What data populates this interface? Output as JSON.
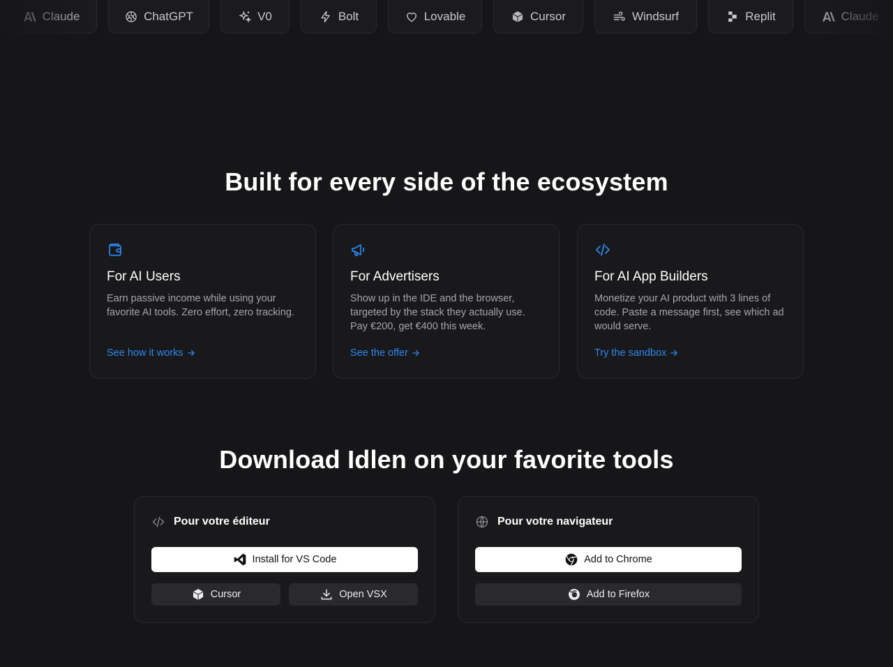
{
  "tool_strip": {
    "items": [
      {
        "label": "Claude",
        "icon": "anthropic-icon"
      },
      {
        "label": "ChatGPT",
        "icon": "openai-icon"
      },
      {
        "label": "V0",
        "icon": "sparkles-icon"
      },
      {
        "label": "Bolt",
        "icon": "bolt-icon"
      },
      {
        "label": "Lovable",
        "icon": "heart-icon"
      },
      {
        "label": "Cursor",
        "icon": "cube-icon"
      },
      {
        "label": "Windsurf",
        "icon": "wind-icon"
      },
      {
        "label": "Replit",
        "icon": "replit-icon"
      },
      {
        "label": "Claude",
        "icon": "anthropic-icon"
      }
    ]
  },
  "ecosystem": {
    "title": "Built for every side of the ecosystem",
    "cards": [
      {
        "icon": "wallet-icon",
        "title": "For AI Users",
        "description": "Earn passive income while using your favorite AI tools. Zero effort, zero tracking.",
        "link": "See how it works"
      },
      {
        "icon": "megaphone-icon",
        "title": "For Advertisers",
        "description": "Show up in the IDE and the browser, targeted by the stack they actually use. Pay €200, get €400 this week.",
        "link": "See the offer"
      },
      {
        "icon": "code-icon",
        "title": "For AI App Builders",
        "description": "Monetize your AI product with 3 lines of code. Paste a message first, see which ad would serve.",
        "link": "Try the sandbox"
      }
    ]
  },
  "download": {
    "title": "Download Idlen on your favorite tools",
    "editor": {
      "heading": "Pour votre éditeur",
      "primary": "Install for VS Code",
      "secondary": [
        "Cursor",
        "Open VSX"
      ]
    },
    "browser": {
      "heading": "Pour votre navigateur",
      "primary": "Add to Chrome",
      "secondary": "Add to Firefox"
    }
  },
  "colors": {
    "background": "#161618",
    "accent": "#2b87f0",
    "card": "#19191b",
    "border": "#29292c"
  }
}
